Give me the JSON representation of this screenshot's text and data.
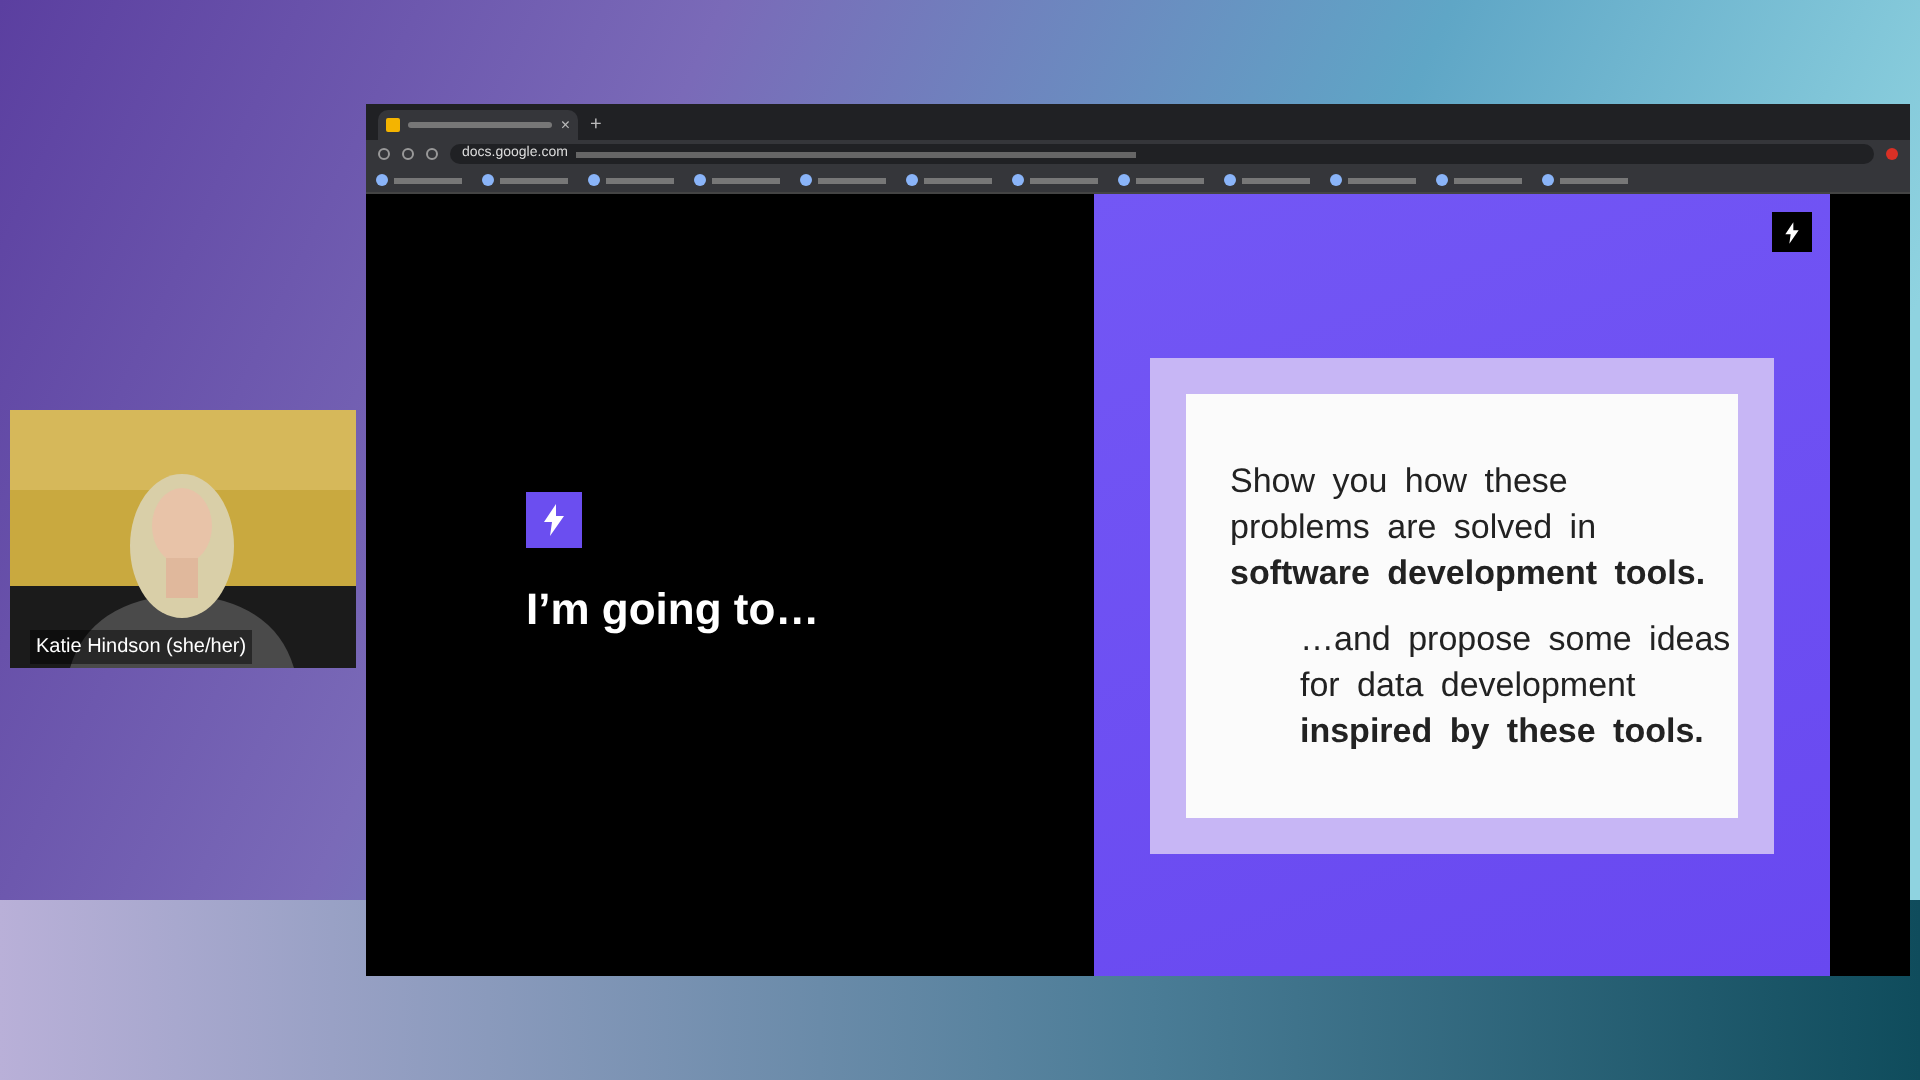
{
  "participant": {
    "name": "Katie Hindson (she/her)",
    "kind": "picture"
  },
  "browser": {
    "new_tab": "+",
    "close_glyph": "×",
    "address": "docs.google.com"
  },
  "slide": {
    "heading": "I’m going to…",
    "paragraphs": [
      {
        "text": "Show you how these problems are solved in **software development tools.**",
        "indented": false
      },
      {
        "text": "…and propose some ideas for data development **inspired by these tools.**",
        "indented": true
      }
    ]
  }
}
